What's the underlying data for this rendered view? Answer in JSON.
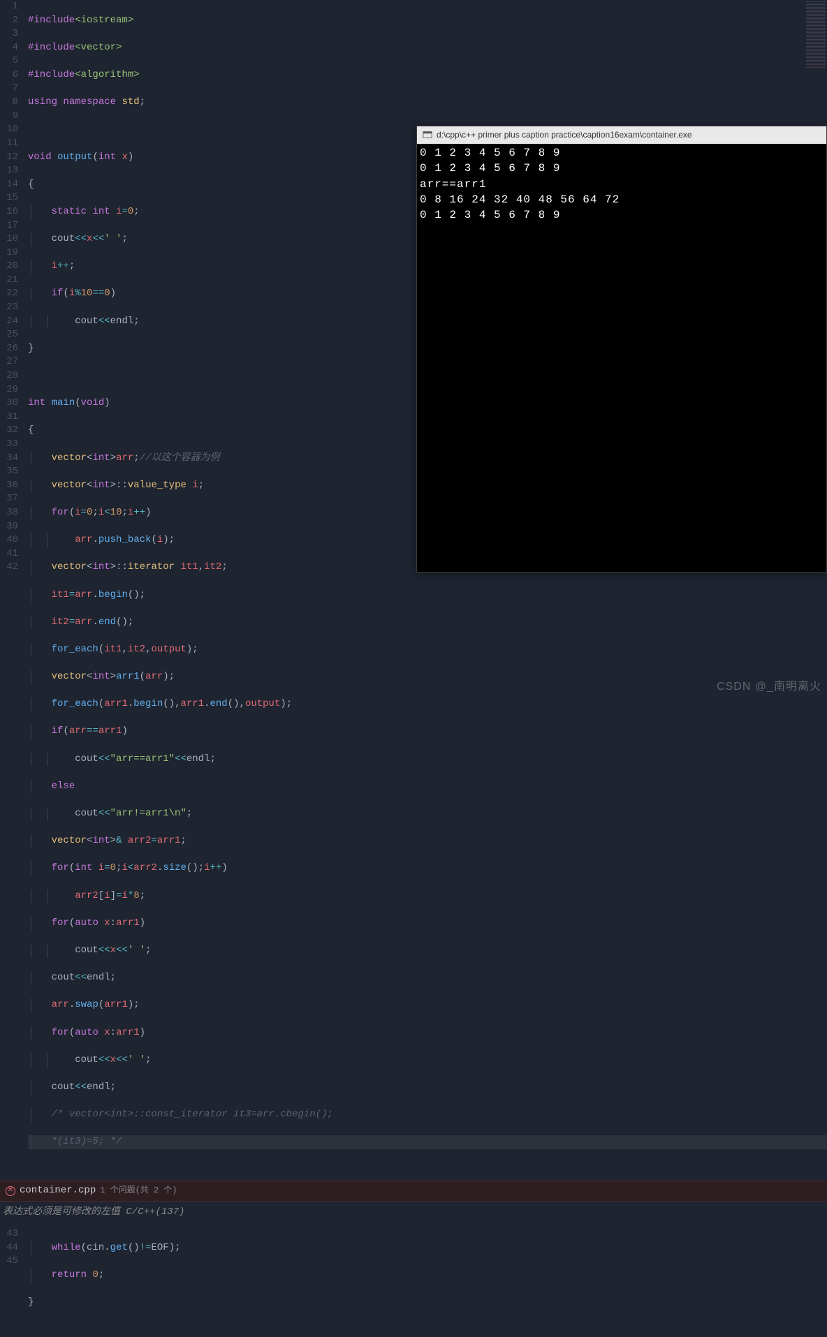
{
  "problems": {
    "filename": "container.cpp",
    "summary": "1 个问题(共 2 个)",
    "message": "表达式必须是可修改的左值",
    "path_suffix": "C/C++(137)"
  },
  "console": {
    "title": "d:\\cpp\\c++ primer plus caption practice\\caption16exam\\container.exe",
    "lines": [
      "0 1 2 3 4 5 6 7 8 9",
      "0 1 2 3 4 5 6 7 8 9",
      "arr==arr1",
      "0 8 16 24 32 40 48 56 64 72",
      "0 1 2 3 4 5 6 7 8 9"
    ]
  },
  "watermark": "CSDN @_南明离火",
  "code": {
    "comments": {
      "line17": "//以这个容器为例",
      "line41": "/* vector<int>::const_iterator it3=arr.cbegin();",
      "line42": "*(it3)=5; */"
    },
    "strings": {
      "arr_eq": "\"arr==arr1\"",
      "arr_ne": "\"arr!=arr1\\n\""
    }
  },
  "line_numbers_top": [
    "1",
    "2",
    "3",
    "4",
    "5",
    "6",
    "7",
    "8",
    "9",
    "10",
    "11",
    "12",
    "13",
    "14",
    "15",
    "16",
    "17",
    "18",
    "19",
    "20",
    "21",
    "22",
    "23",
    "24",
    "25",
    "26",
    "27",
    "28",
    "29",
    "30",
    "31",
    "32",
    "33",
    "34",
    "35",
    "36",
    "37",
    "38",
    "39",
    "40",
    "41",
    "42"
  ],
  "line_numbers_bottom": [
    "43",
    "44",
    "45"
  ]
}
